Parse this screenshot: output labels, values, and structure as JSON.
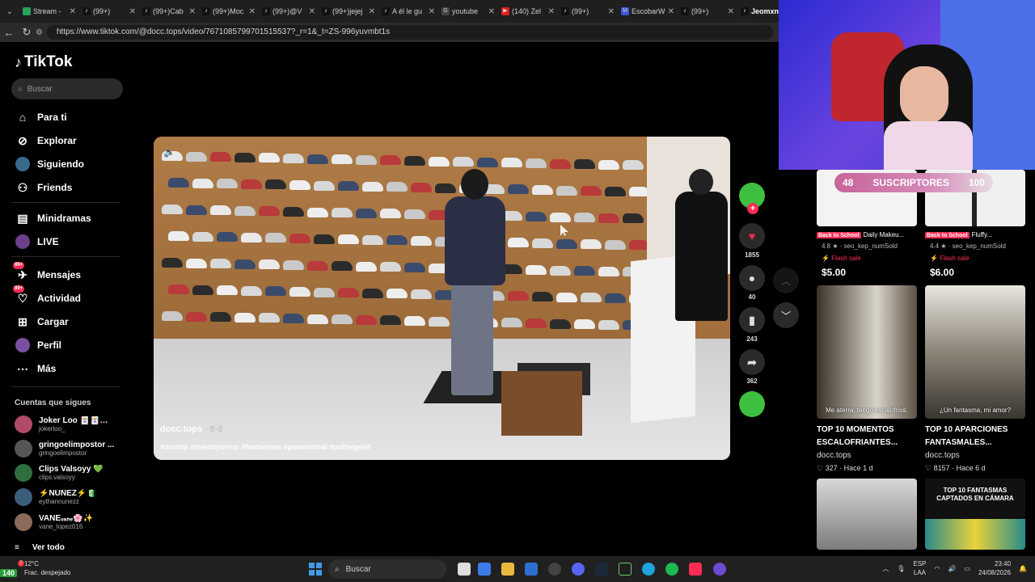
{
  "browser": {
    "tabs": [
      {
        "label": "Stream -",
        "icon": "globe-icon"
      },
      {
        "label": "(99+)",
        "icon": "tiktok-icon"
      },
      {
        "label": "(99+)Cab",
        "icon": "tiktok-icon"
      },
      {
        "label": "(99+)Moc",
        "icon": "tiktok-icon"
      },
      {
        "label": "(99+)@V",
        "icon": "tiktok-icon"
      },
      {
        "label": "(99+)jejej",
        "icon": "tiktok-icon"
      },
      {
        "label": "A él le gu",
        "icon": "tiktok-icon"
      },
      {
        "label": "youtube",
        "icon": "google-icon"
      },
      {
        "label": "(140) Zel",
        "icon": "youtube-icon"
      },
      {
        "label": "(99+)",
        "icon": "tiktok-icon"
      },
      {
        "label": "EscobarW",
        "icon": "letter-m-icon"
      },
      {
        "label": "(99+)",
        "icon": "tiktok-icon"
      },
      {
        "label": "Jeomxn",
        "icon": "tiktok-icon"
      }
    ],
    "url": "https://www.tiktok.com/@docc.tops/video/7671085799701515537?_r=1&_t=ZS-996yuvmbt1s"
  },
  "tiktok": {
    "brand": "TikTok",
    "search_placeholder": "Buscar",
    "nav": [
      {
        "label": "Para ti",
        "icon": "home-icon"
      },
      {
        "label": "Explorar",
        "icon": "compass-icon"
      },
      {
        "label": "Siguiendo",
        "icon": "following-avatar-icon"
      },
      {
        "label": "Friends",
        "icon": "friends-icon"
      }
    ],
    "nav2": [
      {
        "label": "Minidramas",
        "icon": "minidramas-icon"
      },
      {
        "label": "LIVE",
        "icon": "live-icon"
      }
    ],
    "nav3": [
      {
        "label": "Mensajes",
        "badge": "99+",
        "icon": "messages-icon"
      },
      {
        "label": "Actividad",
        "badge": "99+",
        "icon": "activity-icon"
      },
      {
        "label": "Cargar",
        "icon": "upload-icon"
      },
      {
        "label": "Perfil",
        "icon": "profile-icon"
      },
      {
        "label": "Más",
        "icon": "more-icon"
      }
    ],
    "following_title": "Cuentas que sigues",
    "following": [
      {
        "name": "Joker Loo 🃏🃏🃏...",
        "handle": "jokerloo_",
        "color": "#b34a6a"
      },
      {
        "name": "gringoelimpostor ...",
        "handle": "gringoelimpostor",
        "color": "#555555"
      },
      {
        "name": "Clips Valsoyy 💚",
        "handle": "clips.valsoyy",
        "color": "#2f6f3f"
      },
      {
        "name": "⚡NÚÑEZ⚡🧃",
        "handle": "eythannunezz",
        "color": "#3c5d7a"
      },
      {
        "name": "VANEᵥₐₙₑ🌸✨",
        "handle": "vane_lopez016",
        "color": "#8a6a5a"
      }
    ],
    "see_all": "Ver todo"
  },
  "video": {
    "author": "docc.tops",
    "date": "· 8-6",
    "caption": "#doctop #miedoyterror #fantasmas #paranormal #poltergeist",
    "likes": "1855",
    "comments": "40",
    "saves": "243",
    "shares": "362"
  },
  "overlay": {
    "subs_current": "48",
    "subs_label": "SUSCRIPTORES",
    "subs_goal": "100"
  },
  "products": [
    {
      "tag": "Back to School",
      "name": "Daily Makeu...",
      "rating": "4.8 ★ · seo_kep_numSold",
      "flash": "Flash sale",
      "price": "$5.00"
    },
    {
      "tag": "Back to School",
      "name": "Fluffy...",
      "rating": "4.4 ★ · seo_kep_numSold",
      "flash": "Flash sale",
      "price": "$6.00"
    }
  ],
  "related": [
    {
      "title": "TOP 10 MOMENTOS ESCALOFRIANTES...",
      "author": "docc.tops",
      "views": "327",
      "age": "Hace 1 d",
      "subtitle": "Me aterra, tengo escalofríos."
    },
    {
      "title": "TOP 10 APARCIONES FANTASMALES...",
      "author": "docc.tops",
      "views": "8157",
      "age": "Hace 6 d",
      "subtitle": "¿Un fantasma, mi amor?"
    },
    {
      "title": "",
      "author": "",
      "views": "",
      "age": "",
      "subtitle": ""
    },
    {
      "title": "",
      "author": "",
      "views": "",
      "age": "",
      "subtitle": "TOP 10 FANTASMAS CAPTADOS EN CÁMARA"
    }
  ],
  "taskbar": {
    "temp": "12°C",
    "weather": "Frac. despejado",
    "badge": "140",
    "notif": "2",
    "search": "Buscar",
    "lang1": "ESP",
    "lang2": "LAA",
    "time": "23:40",
    "date": "24/08/2026"
  },
  "colors": {
    "accent": "#fe2c55",
    "taskbar": "#202020"
  }
}
